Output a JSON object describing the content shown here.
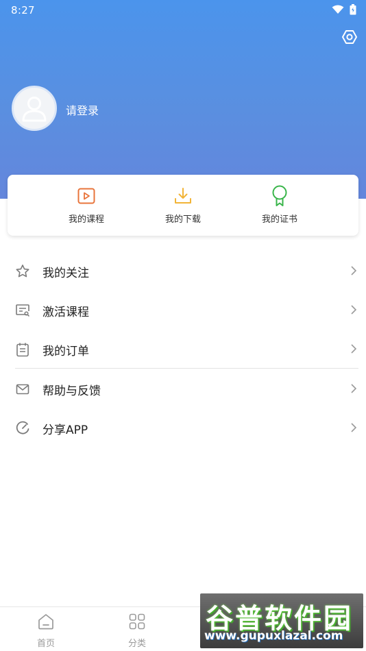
{
  "status_bar": {
    "time": "8:27",
    "wifi_icon": "wifi-icon",
    "battery_icon": "battery-icon"
  },
  "header": {
    "settings_icon": "settings-icon",
    "avatar_icon": "user-avatar-icon",
    "login_text": "请登录"
  },
  "quick_actions": [
    {
      "label": "我的课程",
      "icon": "play-video-icon",
      "color": "#e8743b"
    },
    {
      "label": "我的下载",
      "icon": "download-icon",
      "color": "#f2b437"
    },
    {
      "label": "我的证书",
      "icon": "certificate-icon",
      "color": "#39b54a"
    }
  ],
  "menu": [
    {
      "label": "我的关注",
      "icon": "star-icon"
    },
    {
      "label": "激活课程",
      "icon": "activate-icon"
    },
    {
      "label": "我的订单",
      "icon": "order-icon"
    },
    {
      "label": "帮助与反馈",
      "icon": "mail-icon"
    },
    {
      "label": "分享APP",
      "icon": "share-icon"
    }
  ],
  "bottom_nav": [
    {
      "label": "首页",
      "icon": "home-icon"
    },
    {
      "label": "分类",
      "icon": "grid-icon"
    }
  ],
  "watermark": {
    "title": "谷普软件园",
    "url": "www.gupuxlazal.com"
  },
  "colors": {
    "header_gradient_top": "#4b94ec",
    "header_gradient_bottom": "#6486dc",
    "text_primary": "#222222",
    "text_muted": "#9a9a9a"
  }
}
